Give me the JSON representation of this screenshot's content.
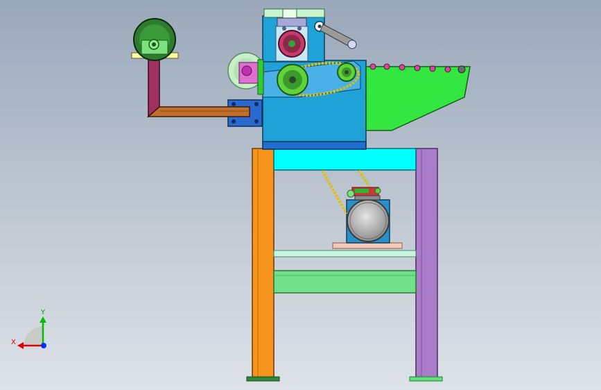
{
  "viewport": {
    "background_top": "#9aa8bb",
    "background_bottom": "#dde2e8"
  },
  "colors": {
    "frame_left_leg": "#f7941d",
    "frame_right_leg": "#a97bc9",
    "top_beam": "#00ffff",
    "lower_beam_1": "#c8f5e0",
    "lower_beam_2": "#72e08a",
    "machine_body": "#1fa2d8",
    "hopper": "#33e640",
    "arm_tube": "#a03060",
    "arm_horizontal": "#c0702a",
    "motor_drum": "#c8c8c8",
    "chain": "#e0c000",
    "sprocket": "#5fd23c"
  },
  "triad": {
    "x_label": "X",
    "y_label": "Y",
    "x_color": "#e00000",
    "y_color": "#00c000",
    "z_color": "#0030ff"
  }
}
